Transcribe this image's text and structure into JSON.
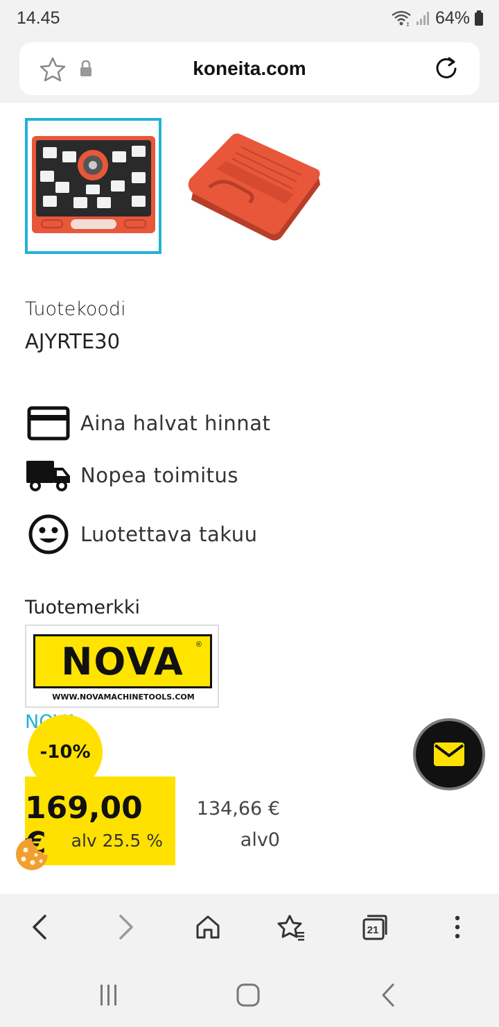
{
  "status_bar": {
    "time": "14.45",
    "battery": "64%",
    "icons": [
      "wifi-icon",
      "signal-icon",
      "battery-icon"
    ]
  },
  "browser": {
    "domain": "koneita.com"
  },
  "product": {
    "code_label": "Tuotekoodi",
    "code_value": "AJYRTE30",
    "features": [
      {
        "icon": "credit-card-icon",
        "label": "Aina halvat hinnat"
      },
      {
        "icon": "truck-icon",
        "label": "Nopea toimitus"
      },
      {
        "icon": "smiley-icon",
        "label": "Luotettava takuu"
      }
    ],
    "brand_label": "Tuotemerkki",
    "brand_logo_text": "NOVA",
    "brand_logo_url": "WWW.NOVAMACHINETOOLS.COM",
    "brand_link": "NOVA",
    "discount": "-10%",
    "price": "169,00 €",
    "price_vat_note": "alv 25.5 %",
    "price_net": "134,66 €",
    "price_net_note": "alv0"
  },
  "colors": {
    "accent_yellow": "#ffe100",
    "link_blue": "#22b2d6",
    "thumb_border": "#22b2d6",
    "case_orange": "#e8573a"
  },
  "browser_nav": {
    "tab_count": "21",
    "icons": [
      "back-icon",
      "forward-icon",
      "home-icon",
      "bookmarks-icon",
      "tabs-icon",
      "menu-icon"
    ]
  },
  "system_nav": {
    "icons": [
      "recents-icon",
      "home-icon",
      "back-icon"
    ]
  }
}
